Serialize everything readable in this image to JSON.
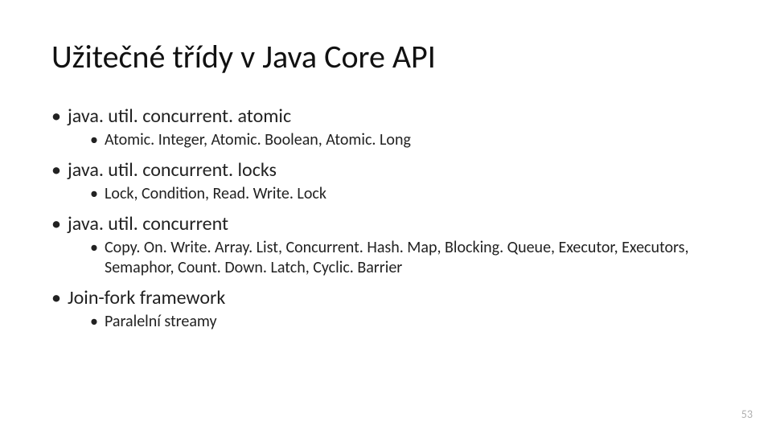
{
  "title": "Užitečné třídy v Java Core API",
  "bullets": [
    {
      "text": "java. util. concurrent. atomic",
      "sub": [
        "Atomic. Integer, Atomic. Boolean, Atomic. Long"
      ]
    },
    {
      "text": "java. util. concurrent. locks",
      "sub": [
        "Lock, Condition, Read. Write. Lock"
      ]
    },
    {
      "text": "java. util. concurrent",
      "sub": [
        "Copy. On. Write. Array. List, Concurrent. Hash. Map, Blocking. Queue, Executor, Executors, Semaphor, Count. Down. Latch, Cyclic. Barrier"
      ]
    },
    {
      "text": "Join-fork framework",
      "sub": [
        "Paralelní streamy"
      ]
    }
  ],
  "page_number": "53"
}
